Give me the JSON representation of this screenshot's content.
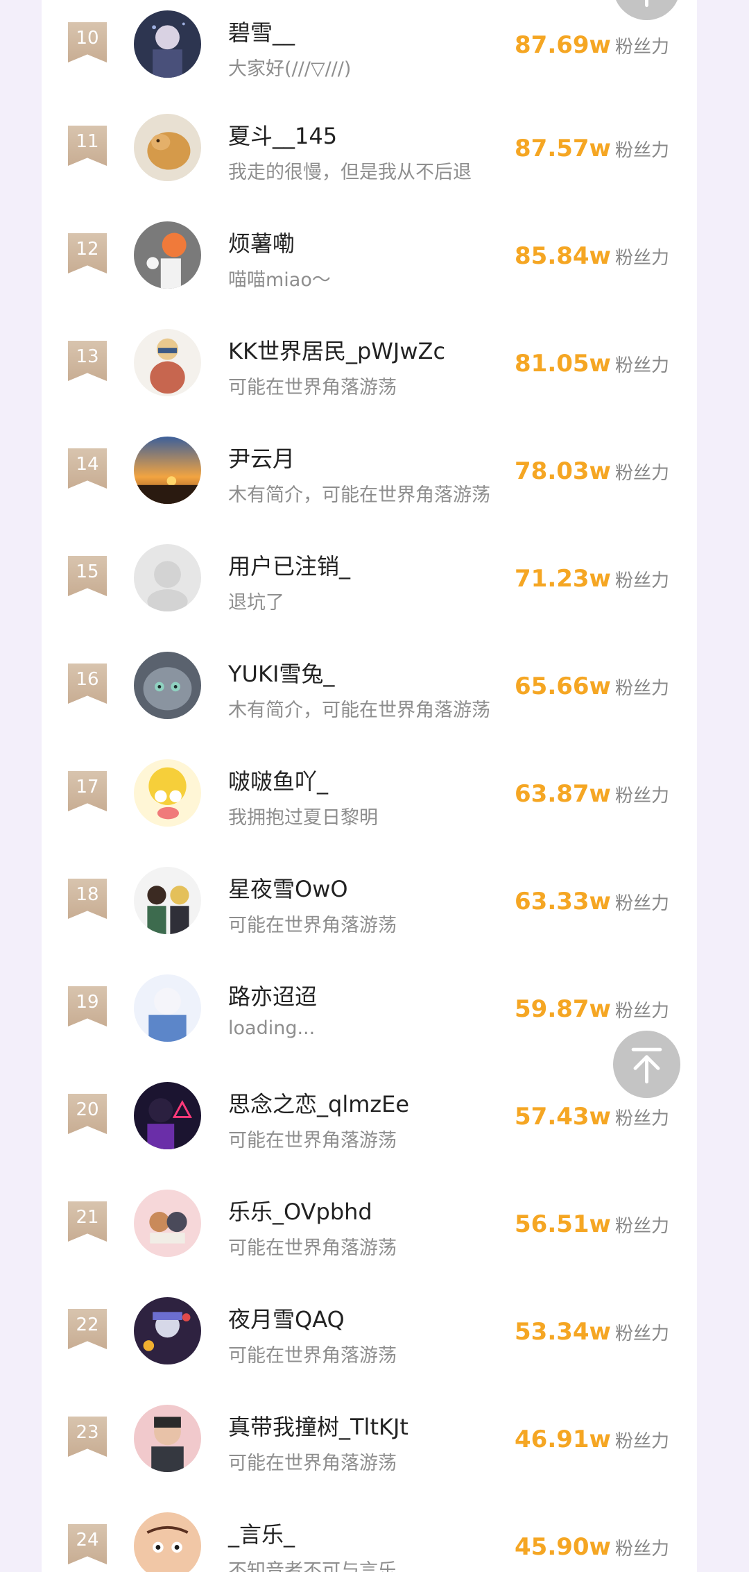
{
  "ranking": {
    "unit_label": "粉丝力",
    "rows": [
      {
        "rank": "10",
        "name": "碧雪__",
        "bio": "大家好(///▽///)",
        "score": "87.69w"
      },
      {
        "rank": "11",
        "name": "夏斗__145",
        "bio": "我走的很慢，但是我从不后退",
        "score": "87.57w"
      },
      {
        "rank": "12",
        "name": "烦薯嘞",
        "bio": "喵喵miao～",
        "score": "85.84w"
      },
      {
        "rank": "13",
        "name": "KK世界居民_pWJwZc",
        "bio": "可能在世界角落游荡",
        "score": "81.05w"
      },
      {
        "rank": "14",
        "name": "尹云月",
        "bio": "木有简介，可能在世界角落游荡",
        "score": "78.03w"
      },
      {
        "rank": "15",
        "name": "用户已注销_",
        "bio": "退坑了",
        "score": "71.23w"
      },
      {
        "rank": "16",
        "name": "YUKI雪兔_",
        "bio": "木有简介，可能在世界角落游荡",
        "score": "65.66w"
      },
      {
        "rank": "17",
        "name": "啵啵鱼吖_",
        "bio": "我拥抱过夏日黎明",
        "score": "63.87w"
      },
      {
        "rank": "18",
        "name": "星夜雪OwO",
        "bio": "可能在世界角落游荡",
        "score": "63.33w"
      },
      {
        "rank": "19",
        "name": "路亦迢迢",
        "bio": "loading...",
        "score": "59.87w"
      },
      {
        "rank": "20",
        "name": "思念之恋_qlmzEe",
        "bio": "可能在世界角落游荡",
        "score": "57.43w"
      },
      {
        "rank": "21",
        "name": "乐乐_OVpbhd",
        "bio": "可能在世界角落游荡",
        "score": "56.51w"
      },
      {
        "rank": "22",
        "name": "夜月雪QAQ",
        "bio": "可能在世界角落游荡",
        "score": "53.34w"
      },
      {
        "rank": "23",
        "name": "真带我撞树_TltKJt",
        "bio": "可能在世界角落游荡",
        "score": "46.91w"
      },
      {
        "rank": "24",
        "name": "_言乐_",
        "bio": "不知音者不可与言乐",
        "score": "45.90w"
      }
    ]
  },
  "colors": {
    "score": "#f5a623",
    "badge": "#c8ad93",
    "background": "#f3effa",
    "back_to_top": "#c4c4c4"
  },
  "icons": {
    "back_to_top": "arrow-up-to-top-icon"
  }
}
